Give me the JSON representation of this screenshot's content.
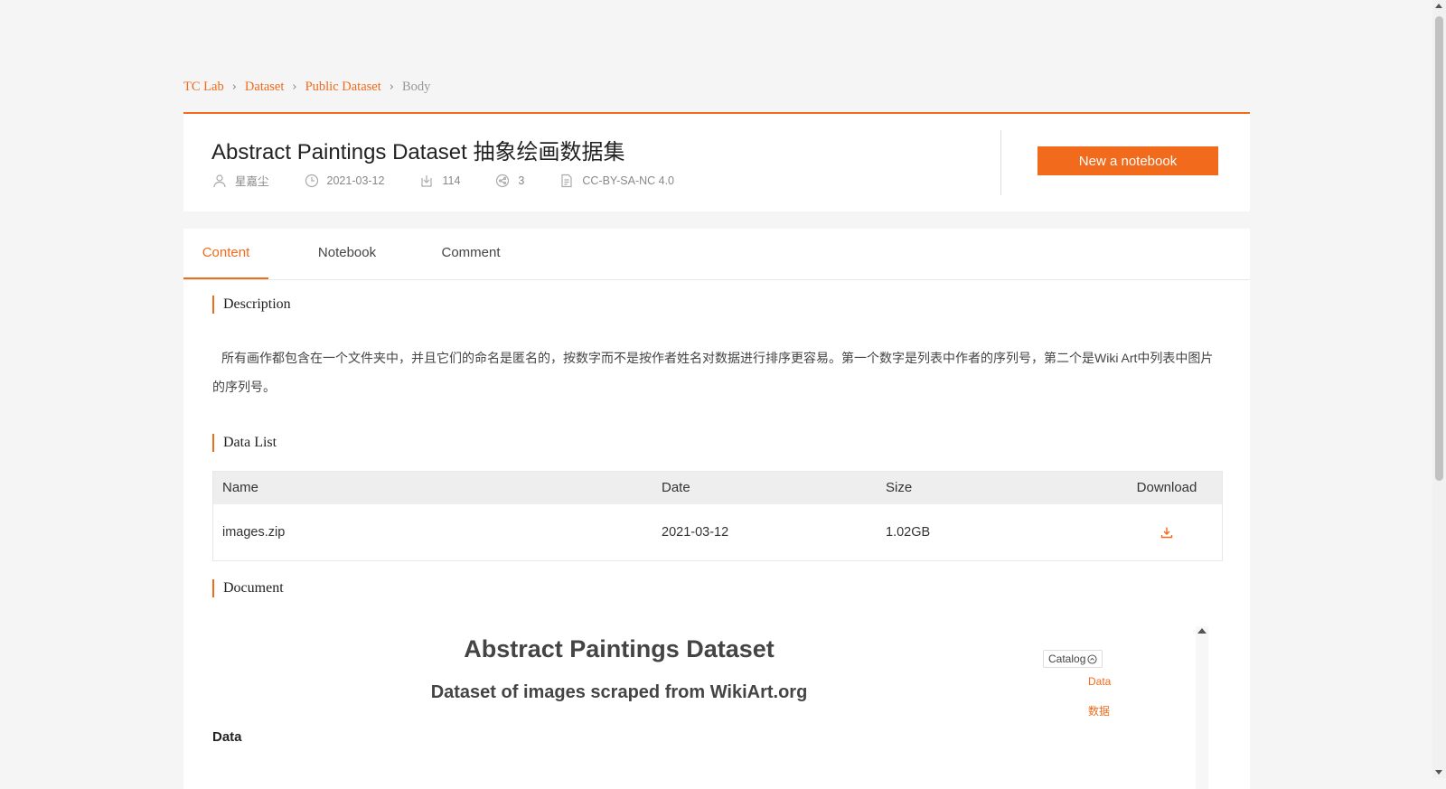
{
  "breadcrumb": {
    "items": [
      "TC Lab",
      "Dataset",
      "Public Dataset"
    ],
    "current": "Body"
  },
  "header": {
    "title": "Abstract Paintings Dataset 抽象绘画数据集",
    "author": "星嘉尘",
    "date": "2021-03-12",
    "downloads": "114",
    "shares": "3",
    "license": "CC-BY-SA-NC 4.0",
    "new_notebook_label": "New a notebook"
  },
  "tabs": [
    "Content",
    "Notebook",
    "Comment"
  ],
  "sections": {
    "description_title": "Description",
    "description_text": "所有画作都包含在一个文件夹中，并且它们的命名是匿名的，按数字而不是按作者姓名对数据进行排序更容易。第一个数字是列表中作者的序列号，第二个是Wiki Art中列表中图片的序列号。",
    "data_list_title": "Data List",
    "document_title": "Document"
  },
  "data_table": {
    "headers": [
      "Name",
      "Date",
      "Size",
      "Download"
    ],
    "rows": [
      {
        "name": "images.zip",
        "date": "2021-03-12",
        "size": "1.02GB"
      }
    ]
  },
  "document": {
    "h1": "Abstract Paintings Dataset",
    "h2": "Dataset of images scraped from WikiArt.org",
    "h3": "Data",
    "catalog_label": "Catalog",
    "catalog_items": [
      "Data",
      "数据"
    ]
  },
  "colors": {
    "accent": "#f26a1b",
    "page_bg": "#f5f5f5",
    "card_bg": "#ffffff"
  },
  "icons": [
    "user-icon",
    "clock-icon",
    "download-box-icon",
    "share-icon",
    "document-icon",
    "chevron-right-icon",
    "download-icon",
    "circle-up-icon"
  ]
}
